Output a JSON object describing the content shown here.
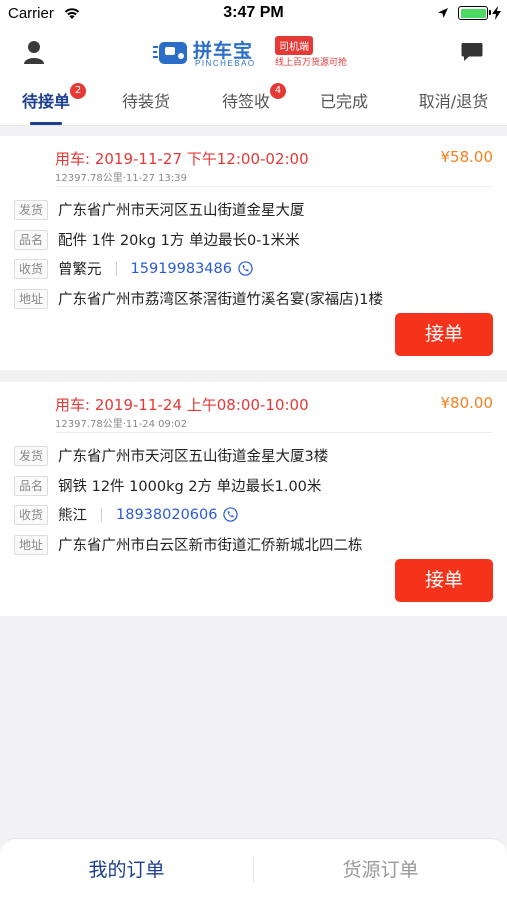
{
  "status_bar": {
    "carrier": "Carrier",
    "time": "3:47 PM"
  },
  "header": {
    "logo_cn": "拼车宝",
    "logo_en": "PINCHEBAO",
    "badge": "司机端",
    "slogan": "线上百万货源可抢",
    "brand_color": "#2a6ec7"
  },
  "tabs": [
    {
      "label": "待接单",
      "badge": "2",
      "active": true
    },
    {
      "label": "待装货"
    },
    {
      "label": "待签收",
      "badge": "4"
    },
    {
      "label": "已完成"
    },
    {
      "label": "取消/退货"
    }
  ],
  "orders": [
    {
      "use_time": "用车: 2019-11-27 下午12:00-02:00",
      "price": "¥58.00",
      "sub_info": "12397.78公里·11-27 13:39",
      "ship_tag": "发货",
      "ship_address": "广东省广州市天河区五山街道金星大厦",
      "goods_tag": "品名",
      "goods": "配件 1件 20kg 1方 单边最长0-1米米",
      "receiver_tag": "收货",
      "receiver": "曾繁元",
      "phone": "15919983486",
      "address_tag": "地址",
      "address": "广东省广州市荔湾区茶滘街道竹溪名宴(家福店)1楼",
      "accept_label": "接单"
    },
    {
      "use_time": "用车: 2019-11-24 上午08:00-10:00",
      "price": "¥80.00",
      "sub_info": "12397.78公里·11-24 09:02",
      "ship_tag": "发货",
      "ship_address": "广东省广州市天河区五山街道金星大厦3楼",
      "goods_tag": "品名",
      "goods": "钢铁 12件 1000kg 2方 单边最长1.00米",
      "receiver_tag": "收货",
      "receiver": "熊江",
      "phone": "18938020606",
      "address_tag": "地址",
      "address": "广东省广州市白云区新市街道汇侨新城北四二栋",
      "accept_label": "接单"
    }
  ],
  "bottom_nav": [
    {
      "label": "我的订单",
      "active": true
    },
    {
      "label": "货源订单"
    }
  ],
  "colors": {
    "accent": "#1c3f8f",
    "alert": "#e53935",
    "price": "#f5801f",
    "button": "#f5331a"
  }
}
